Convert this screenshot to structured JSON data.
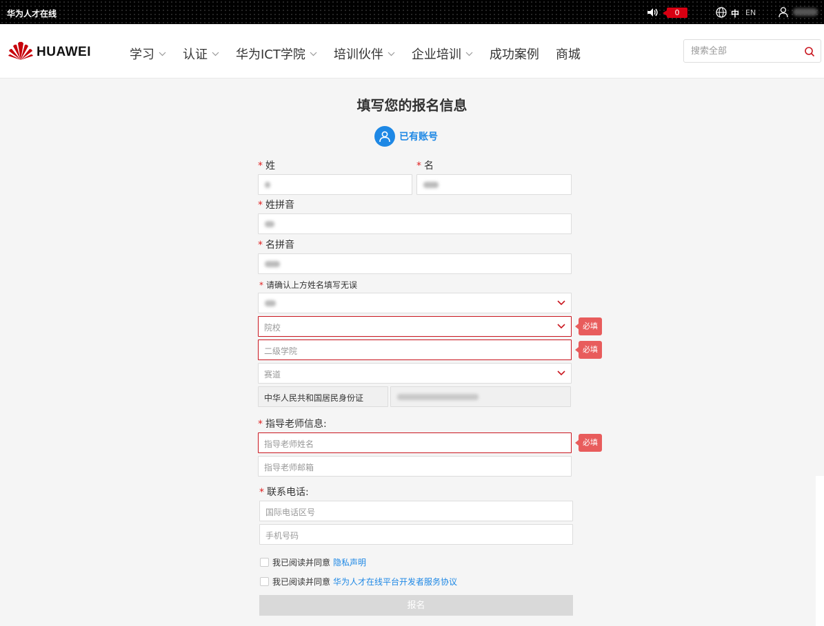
{
  "topbar": {
    "site_name": "华为人才在线",
    "notification_count": "0",
    "lang_zh": "中",
    "lang_en": "EN"
  },
  "nav": {
    "logo_text": "HUAWEI",
    "items": [
      {
        "label": "学习",
        "has_dropdown": true
      },
      {
        "label": "认证",
        "has_dropdown": true
      },
      {
        "label": "华为ICT学院",
        "has_dropdown": true
      },
      {
        "label": "培训伙伴",
        "has_dropdown": true
      },
      {
        "label": "企业培训",
        "has_dropdown": true
      },
      {
        "label": "成功案例",
        "has_dropdown": false
      },
      {
        "label": "商城",
        "has_dropdown": false
      }
    ],
    "search_placeholder": "搜索全部"
  },
  "form": {
    "title": "填写您的报名信息",
    "account_link": "已有账号",
    "labels": {
      "surname": "姓",
      "given_name": "名",
      "surname_pinyin": "姓拼音",
      "given_pinyin": "名拼音",
      "confirm": "请确认上方姓名填写无误",
      "teacher": "指导老师信息:",
      "phone": "联系电话:"
    },
    "placeholders": {
      "school": "院校",
      "college": "二级学院",
      "track": "赛道",
      "teacher_name": "指导老师姓名",
      "teacher_email": "指导老师邮箱",
      "intl_code": "国际电话区号",
      "mobile": "手机号码"
    },
    "id_type": "中华人民共和国居民身份证",
    "required_tag": "必填",
    "agree_prefix": "我已阅读并同意",
    "privacy_link": "隐私声明",
    "service_link": "华为人才在线平台开发者服务协议",
    "submit_label": "报名"
  },
  "colors": {
    "brand_red": "#c9151e",
    "link_blue": "#1e88e5",
    "badge_red": "#d80012",
    "required_tag": "#e85c5c"
  }
}
